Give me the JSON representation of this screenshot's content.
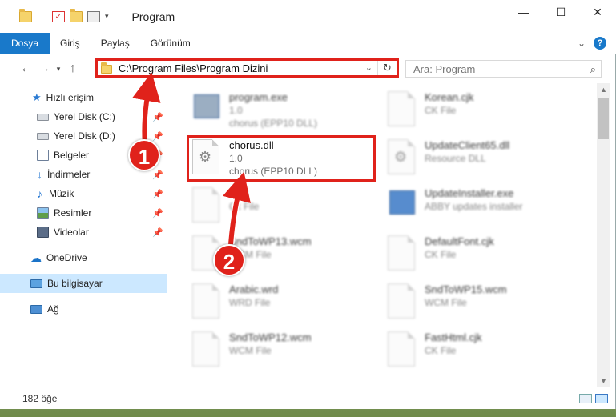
{
  "titlebar": {
    "title": "Program",
    "buttons": {
      "minimize": "—",
      "maximize": "☐",
      "close": "✕"
    }
  },
  "ribbon": {
    "tabs": [
      {
        "label": "Dosya",
        "active": true
      },
      {
        "label": "Giriş"
      },
      {
        "label": "Paylaş"
      },
      {
        "label": "Görünüm"
      }
    ]
  },
  "address": {
    "path": "C:\\Program Files\\Program Dizini",
    "search_placeholder": "Ara: Program"
  },
  "sidebar": {
    "items": [
      {
        "label": "Hızlı erişim",
        "icon": "star-icon"
      },
      {
        "label": "Yerel Disk (C:)",
        "icon": "drive-icon",
        "pinned": true
      },
      {
        "label": "Yerel Disk (D:)",
        "icon": "drive-icon",
        "pinned": true
      },
      {
        "label": "Belgeler",
        "icon": "documents-icon",
        "pinned": true
      },
      {
        "label": "İndirmeler",
        "icon": "download-icon",
        "pinned": true
      },
      {
        "label": "Müzik",
        "icon": "music-icon",
        "pinned": true
      },
      {
        "label": "Resimler",
        "icon": "pictures-icon",
        "pinned": true
      },
      {
        "label": "Videolar",
        "icon": "videos-icon",
        "pinned": true
      },
      {
        "label": "OneDrive",
        "icon": "cloud-icon"
      },
      {
        "label": "Bu bilgisayar",
        "icon": "computer-icon",
        "selected": true
      },
      {
        "label": "Ağ",
        "icon": "network-icon"
      }
    ]
  },
  "files": {
    "left": [
      {
        "name": "program.exe",
        "line2": "1.0",
        "line3": "chorus (EPP10 DLL)",
        "blurred": true
      },
      {
        "name": "chorus.dll",
        "line2": "1.0",
        "line3": "chorus (EPP10 DLL)",
        "highlighted": true
      },
      {
        "name": "...ck",
        "line2": "Ck File",
        "blurred": true
      },
      {
        "name": "SndToWP13.wcm",
        "line2": "WCM File",
        "blurred": true
      },
      {
        "name": "Arabic.wrd",
        "line2": "WRD File",
        "blurred": true
      },
      {
        "name": "SndToWP12.wcm",
        "line2": "WCM File",
        "blurred": true
      }
    ],
    "right": [
      {
        "name": "Korean.cjk",
        "line2": "CK File",
        "blurred": true
      },
      {
        "name": "UpdateClient65.dll",
        "line2": "Resource DLL",
        "blurred": true
      },
      {
        "name": "UpdateInstaller.exe",
        "line2": "ABBY updates installer",
        "blurred": true
      },
      {
        "name": "DefaultFont.cjk",
        "line2": "CK File",
        "blurred": true
      },
      {
        "name": "SndToWP15.wcm",
        "line2": "WCM File",
        "blurred": true
      },
      {
        "name": "FastHtml.cjk",
        "line2": "CK File",
        "blurred": true
      }
    ]
  },
  "annotations": {
    "marker1": "1",
    "marker2": "2",
    "color": "#e0221b"
  },
  "status": {
    "item_count": "182 öğe"
  }
}
